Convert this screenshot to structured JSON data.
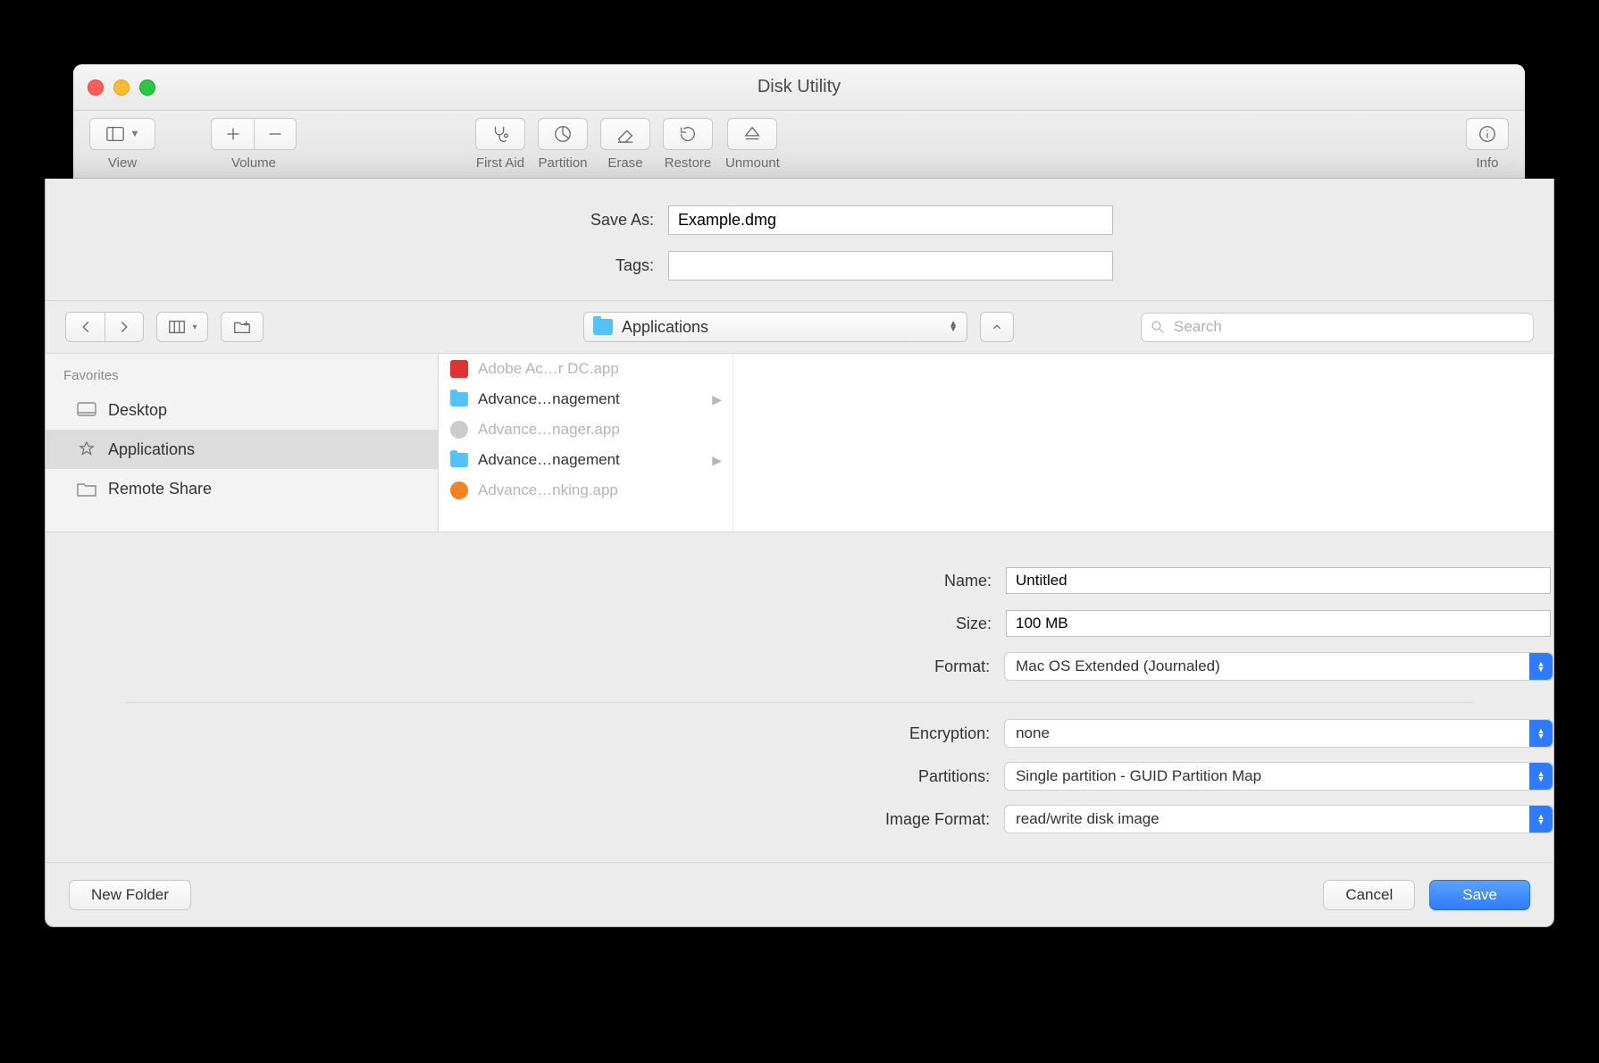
{
  "window": {
    "title": "Disk Utility"
  },
  "toolbar": {
    "view": "View",
    "volume": "Volume",
    "first_aid": "First Aid",
    "partition": "Partition",
    "erase": "Erase",
    "restore": "Restore",
    "unmount": "Unmount",
    "info": "Info"
  },
  "sheet": {
    "save_as_label": "Save As:",
    "save_as_value": "Example.dmg",
    "tags_label": "Tags:",
    "tags_value": "",
    "location": "Applications",
    "search_placeholder": "Search",
    "favorites_header": "Favorites",
    "favorites": [
      {
        "label": "Desktop",
        "icon": "desktop",
        "selected": false
      },
      {
        "label": "Applications",
        "icon": "applications",
        "selected": true
      },
      {
        "label": "Remote Share",
        "icon": "folder",
        "selected": false
      }
    ],
    "files": [
      {
        "label": "Adobe Ac…r DC.app",
        "type": "app-red",
        "dim": true,
        "arrow": false
      },
      {
        "label": "Advance…nagement",
        "type": "folder",
        "dim": false,
        "arrow": true
      },
      {
        "label": "Advance…nager.app",
        "type": "app-grey",
        "dim": true,
        "arrow": false
      },
      {
        "label": "Advance…nagement",
        "type": "folder",
        "dim": false,
        "arrow": true
      },
      {
        "label": "Advance…nking.app",
        "type": "app-orange",
        "dim": true,
        "arrow": false
      }
    ],
    "form": {
      "name_label": "Name:",
      "name_value": "Untitled",
      "size_label": "Size:",
      "size_value": "100 MB",
      "format_label": "Format:",
      "format_value": "Mac OS Extended (Journaled)",
      "encryption_label": "Encryption:",
      "encryption_value": "none",
      "partitions_label": "Partitions:",
      "partitions_value": "Single partition - GUID Partition Map",
      "image_format_label": "Image Format:",
      "image_format_value": "read/write disk image"
    },
    "buttons": {
      "new_folder": "New Folder",
      "cancel": "Cancel",
      "save": "Save"
    }
  }
}
